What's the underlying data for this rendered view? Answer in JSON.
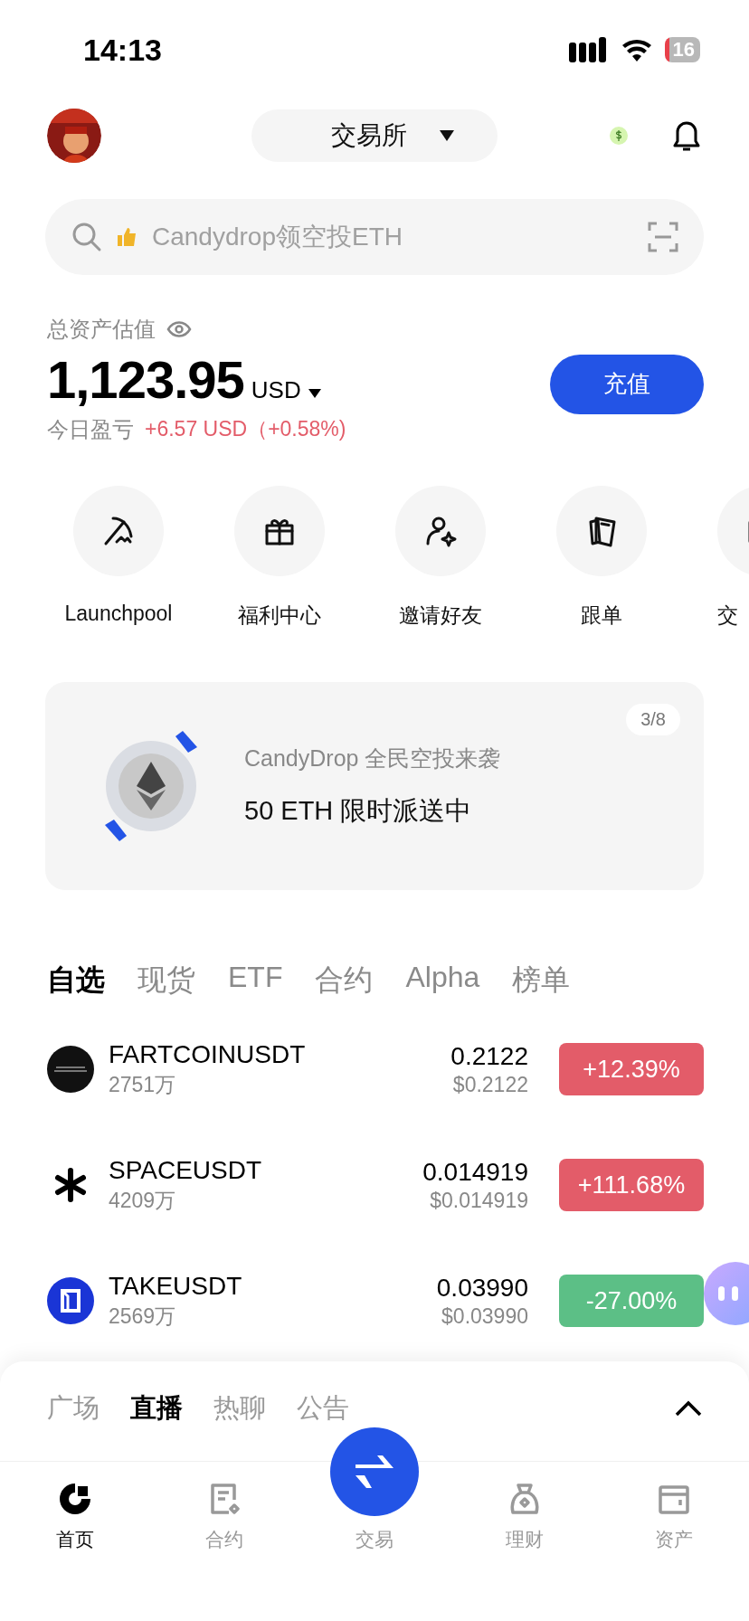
{
  "status_bar": {
    "time": "14:13",
    "battery": "16"
  },
  "header": {
    "switcher": "交易所"
  },
  "search": {
    "placeholder": "Candydrop领空投ETH"
  },
  "assets": {
    "label": "总资产估值",
    "amount": "1,123.95",
    "currency": "USD",
    "pnl_label": "今日盈亏",
    "pnl": "+6.57 USD（+0.58%)",
    "deposit": "充值"
  },
  "shortcuts": [
    {
      "kind": "pickaxe",
      "label": "Launchpool"
    },
    {
      "kind": "gift",
      "label": "福利中心"
    },
    {
      "kind": "invite",
      "label": "邀请好友"
    },
    {
      "kind": "cards",
      "label": "跟单"
    },
    {
      "kind": "partial",
      "label": "交"
    }
  ],
  "banner": {
    "page": "3/8",
    "subtitle": "CandyDrop 全民空投来袭",
    "title": "50 ETH 限时派送中"
  },
  "market_tabs": [
    {
      "label": "自选",
      "selected": true
    },
    {
      "label": "现货",
      "selected": false
    },
    {
      "label": "ETF",
      "selected": false
    },
    {
      "label": "合约",
      "selected": false
    },
    {
      "label": "Alpha",
      "selected": false
    },
    {
      "label": "榜单",
      "selected": false
    }
  ],
  "rows": [
    {
      "kind": "fart",
      "symbol": "FARTCOINUSDT",
      "volume": "2751万",
      "price": "0.2122",
      "usd": "$0.2122",
      "change": "+12.39%",
      "color": "#e35c69"
    },
    {
      "kind": "space",
      "symbol": "SPACEUSDT",
      "volume": "4209万",
      "price": "0.014919",
      "usd": "$0.014919",
      "change": "+111.68%",
      "color": "#e35c69"
    },
    {
      "kind": "take",
      "symbol": "TAKEUSDT",
      "volume": "2569万",
      "price": "0.03990",
      "usd": "$0.03990",
      "change": "-27.00%",
      "color": "#5cbf86"
    }
  ],
  "feed_tabs": [
    {
      "label": "广场",
      "selected": false
    },
    {
      "label": "直播",
      "selected": true
    },
    {
      "label": "热聊",
      "selected": false
    },
    {
      "label": "公告",
      "selected": false
    }
  ],
  "nav": [
    {
      "kind": "home",
      "label": "首页",
      "selected": true
    },
    {
      "kind": "contract",
      "label": "合约",
      "selected": false
    },
    {
      "kind": "trade",
      "label": "交易",
      "selected": false
    },
    {
      "kind": "earn",
      "label": "理财",
      "selected": false
    },
    {
      "kind": "wallet",
      "label": "资产",
      "selected": false
    }
  ]
}
